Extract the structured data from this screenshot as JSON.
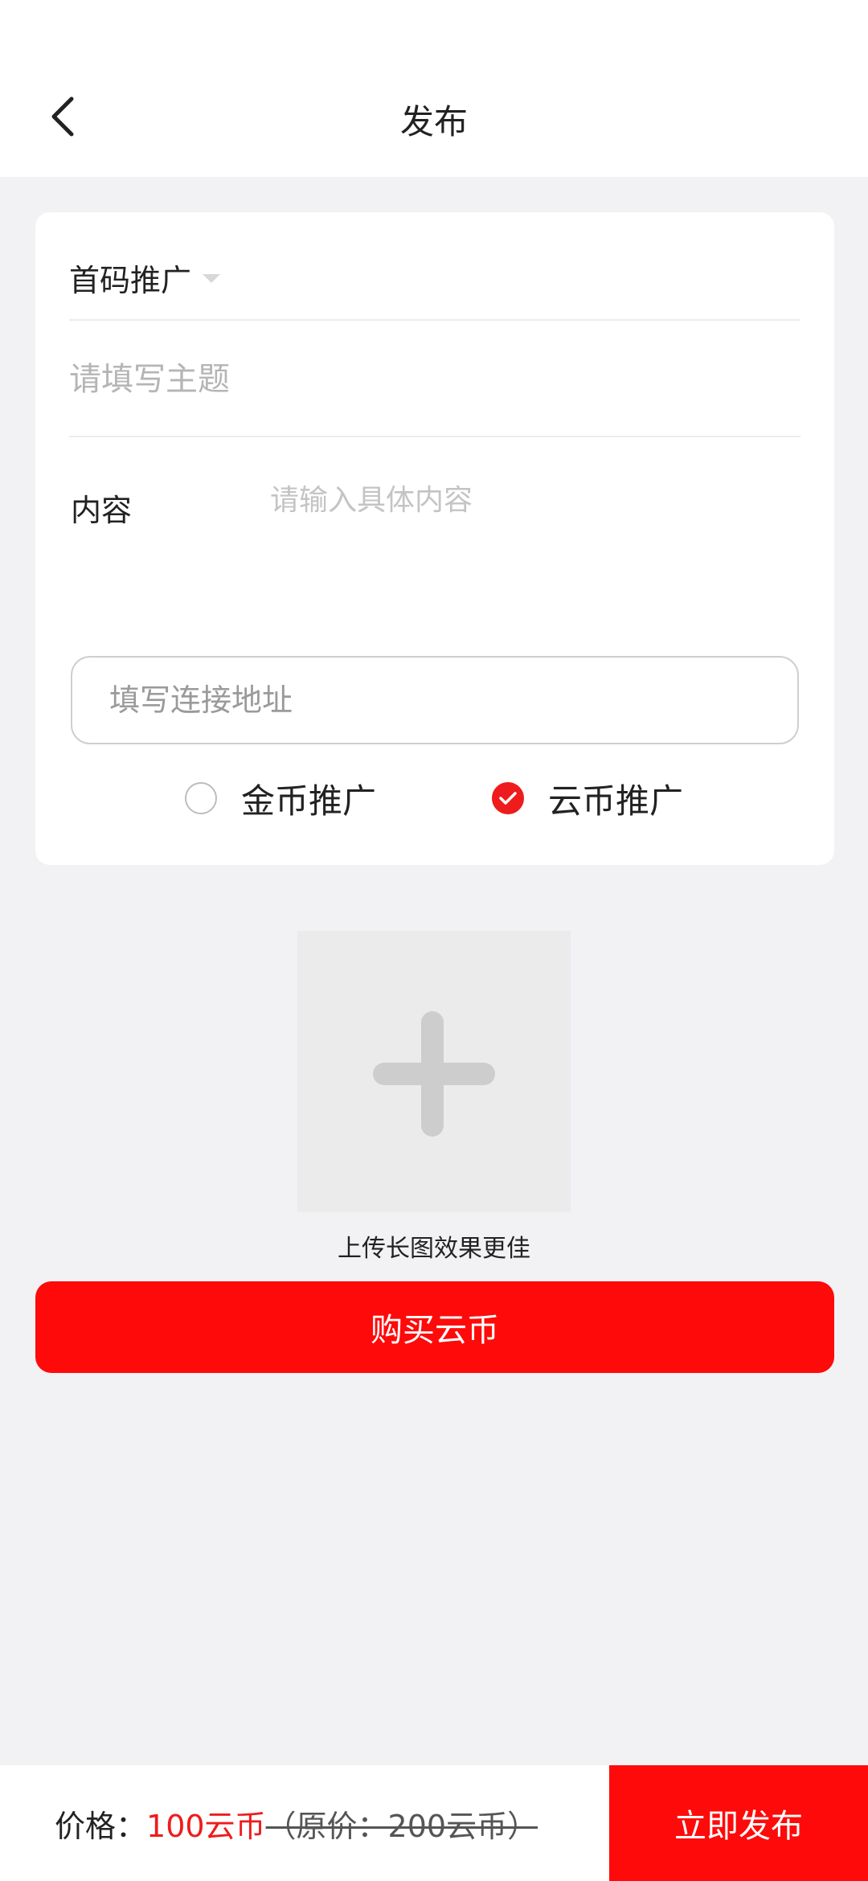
{
  "header": {
    "title": "发布",
    "back_icon": "chevron-left-icon"
  },
  "form": {
    "category_label": "首码推广",
    "category_icon": "caret-down-icon",
    "subject_placeholder": "请填写主题",
    "content_label": "内容",
    "content_placeholder": "请输入具体内容",
    "link_placeholder": "填写连接地址",
    "promotion_options": [
      {
        "label": "金币推广",
        "selected": false
      },
      {
        "label": "云币推广",
        "selected": true
      }
    ]
  },
  "upload": {
    "icon": "plus-icon",
    "hint": "上传长图效果更佳"
  },
  "buy_button_label": "购买云币",
  "footer": {
    "price_label": "价格：",
    "price_value": "100云币",
    "original_price": "（原价：200云币）",
    "publish_label": "立即发布"
  },
  "colors": {
    "accent": "#ff0a0a",
    "price_text": "#ee1c1c",
    "background": "#f2f2f5"
  }
}
